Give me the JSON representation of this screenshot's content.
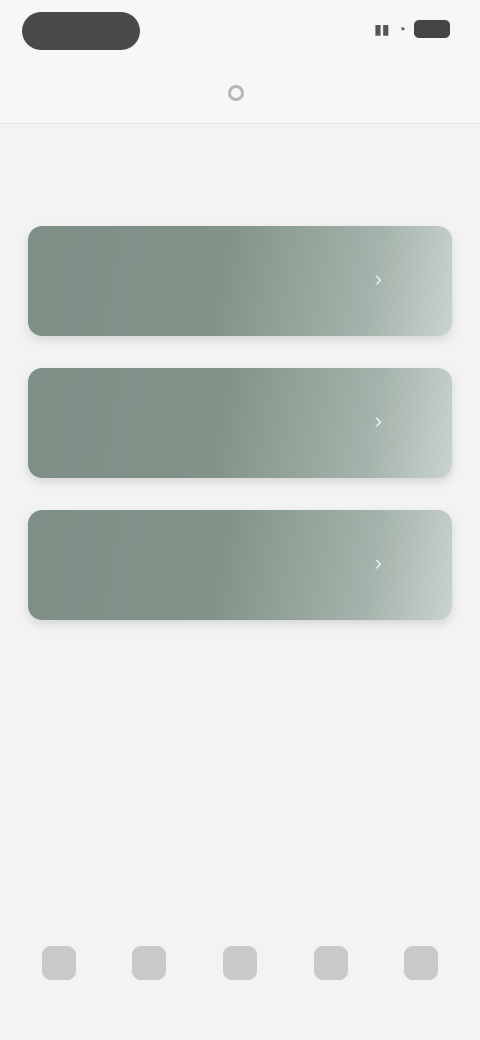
{
  "status_bar": {
    "time": "",
    "signal_icon": "signal-icon",
    "wifi_icon": "wifi-icon",
    "battery_icon": "battery-icon"
  },
  "nav": {
    "title": "",
    "logo_icon": "logo-icon"
  },
  "section": {
    "label": ""
  },
  "cards": [
    {
      "title": "",
      "arrow_icon": "arrow-icon"
    },
    {
      "title": "",
      "arrow_icon": "arrow-icon"
    },
    {
      "title": "",
      "arrow_icon": "arrow-icon"
    }
  ],
  "tabs": [
    {
      "label": "",
      "icon": "home-icon"
    },
    {
      "label": "",
      "icon": "grid-icon"
    },
    {
      "label": "",
      "icon": "book-icon"
    },
    {
      "label": "",
      "icon": "chat-icon"
    },
    {
      "label": "",
      "icon": "profile-icon"
    }
  ],
  "colors": {
    "background": "#f3f3f3",
    "card_start": "#7d8f86",
    "card_end": "#c9d3ce"
  }
}
